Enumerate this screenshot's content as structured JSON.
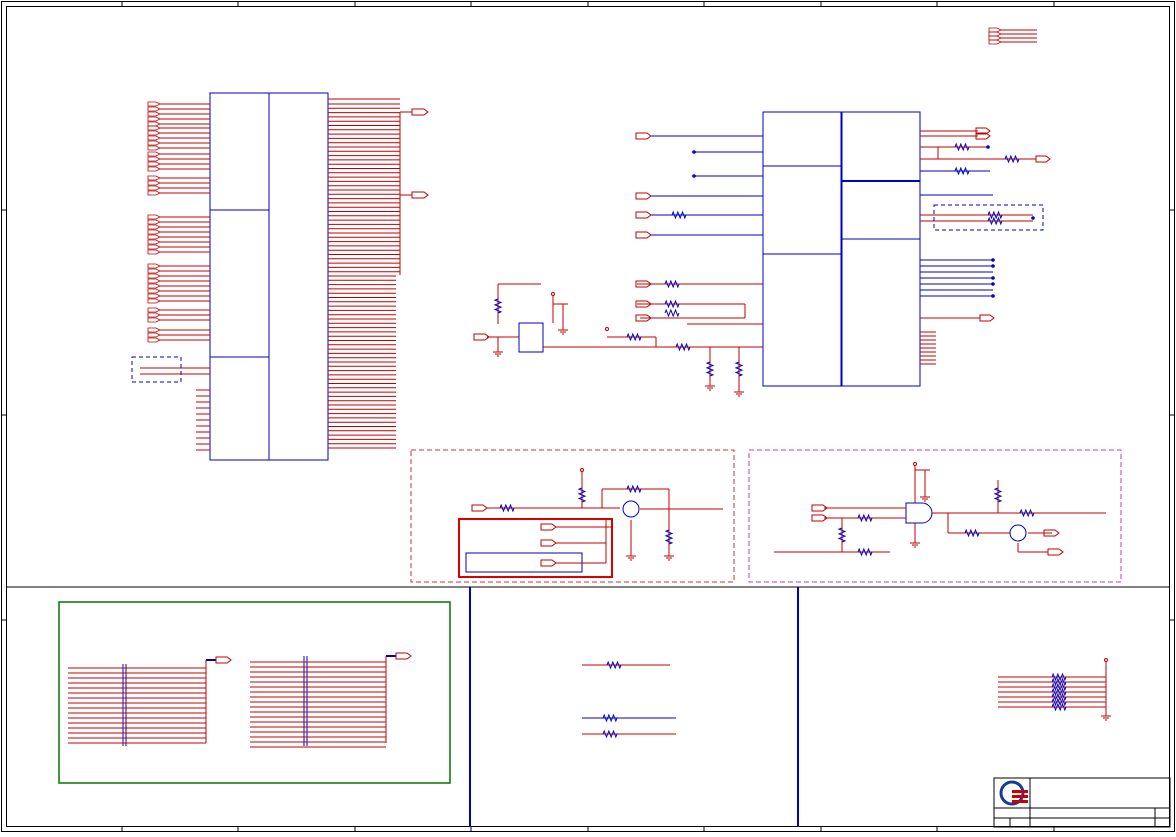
{
  "sheet": {
    "title": "",
    "colors": {
      "border": "#000000",
      "block": "#0000c8",
      "net": "#c00000",
      "frame_red": "#cc3333",
      "frame_magenta": "#cc33cc",
      "frame_green": "#007700",
      "frame_blue": "#0000c8"
    },
    "logo": {
      "name": "company-logo-icon"
    }
  }
}
